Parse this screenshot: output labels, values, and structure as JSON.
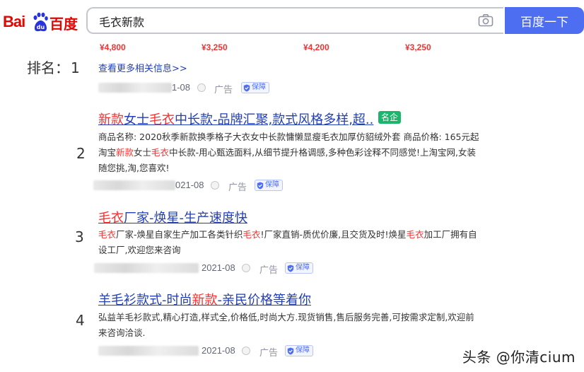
{
  "header": {
    "logo_en": "Bai",
    "logo_cn": "百度",
    "search_value": "毛衣新款",
    "search_button": "百度一下"
  },
  "prices": [
    "¥4,800",
    "¥3,250",
    "¥4,200",
    "¥3,250"
  ],
  "rank_label": "排名：",
  "more_link": "查看更多相关信息>>",
  "top_meta": {
    "date": "1-08",
    "ad": "广告",
    "guarantee": "保障"
  },
  "results": [
    {
      "rank": "1"
    },
    {
      "rank": "2",
      "title_parts": [
        "新款",
        "女士",
        "毛衣",
        "中长款-品牌汇聚,款式风格多样,超.."
      ],
      "badge": "名企",
      "desc_line1": "商品名称: 2020秋季新款换季格子大衣女中长款慵懒显瘦毛衣加厚仿貂绒外套    商品价格: 165元起",
      "desc_line2_parts": [
        "淘宝",
        "新款",
        "女士",
        "毛衣",
        "中长款-用心甄选面料,从细节提升格调感,多种色彩诠释不同感觉!上淘宝网,女装"
      ],
      "desc_line3": "随您挑,淘,您喜欢!",
      "date": "021-08",
      "ad": "广告",
      "guarantee": "保障"
    },
    {
      "rank": "3",
      "title_parts": [
        "毛衣",
        "厂家-焕星-生产速度快"
      ],
      "desc_line1_parts": [
        "毛衣",
        "厂家-焕星自家生产加工各类针织",
        "毛衣",
        "!厂家直销-质优价廉,且交货及时!焕星",
        "毛衣",
        "加工厂拥有自"
      ],
      "desc_line2": "设工厂,欢迎您来咨询",
      "date": "2021-08",
      "ad": "广告",
      "guarantee": "保障"
    },
    {
      "rank": "4",
      "title_parts": [
        "羊毛衫款式-时尚",
        "新款",
        "-亲民价格等着你"
      ],
      "desc_line1": "弘益羊毛衫款式,精心打造,样式全,价格低,时尚大方.现货销售,售后服务完善,可按需求定制,欢迎前",
      "desc_line2": "来咨询洽谈.",
      "date": "2021-08",
      "ad": "广告",
      "guarantee": "保障"
    }
  ],
  "watermark": "头条 @你清cium",
  "colors": {
    "brand_blue": "#4e6ef2",
    "link_blue": "#2440b3",
    "highlight_red": "#f73131",
    "badge_green": "#1cb56b"
  }
}
